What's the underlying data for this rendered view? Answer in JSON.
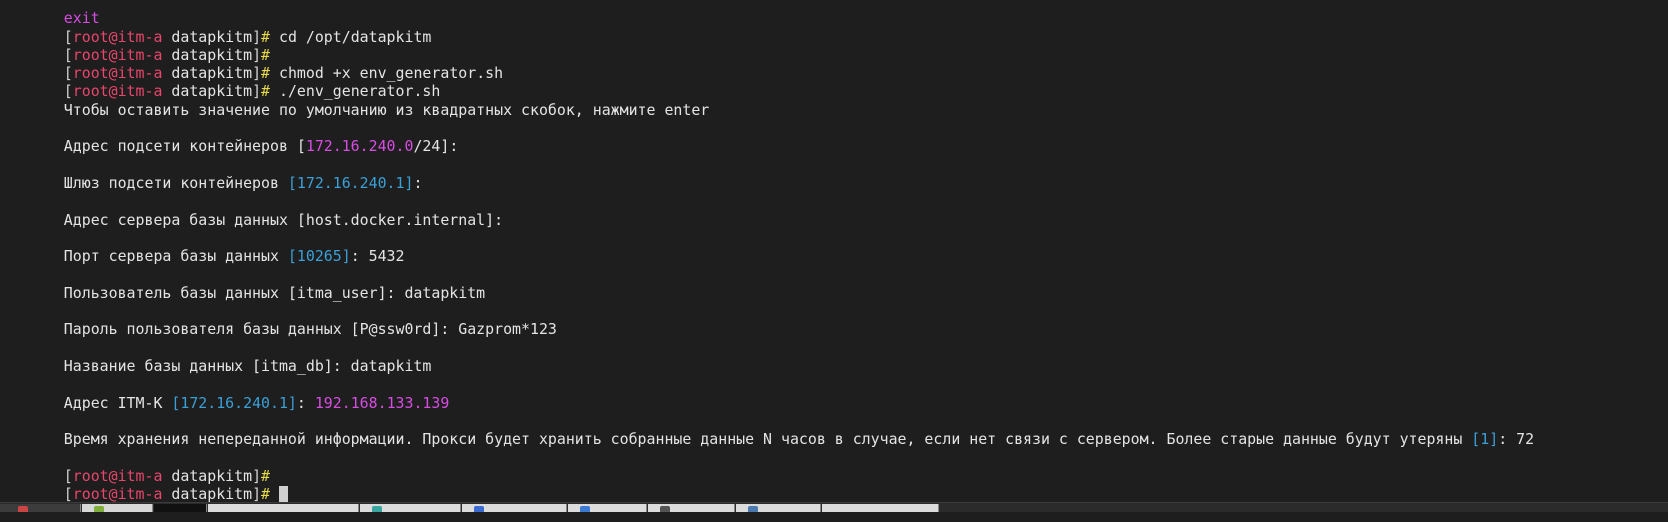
{
  "terminal": {
    "top_partial": "exit",
    "prompt": {
      "open": "[",
      "user_host": "root@itm-a",
      "dir": "datapkitm",
      "close": "]",
      "hash": "#"
    },
    "commands": [
      " cd /opt/datapkitm",
      "",
      " chmod +x env_generator.sh",
      " ./env_generator.sh"
    ],
    "intro": "Чтобы оставить значение по умолчанию из квадратных скобок, нажмите enter",
    "q_subnet": {
      "label": "Адрес подсети контейнеров [",
      "ip": "172.16.240.0",
      "mask": "/24",
      "end": "]:"
    },
    "q_gateway": {
      "label": "Шлюз подсети контейнеров ",
      "default": "[172.16.240.1]",
      "end": ":"
    },
    "q_db_host": "Адрес сервера базы данных [host.docker.internal]:",
    "q_db_port": {
      "label": "Порт сервера базы данных ",
      "default": "[10265]",
      "end": ": ",
      "answer": "5432"
    },
    "q_db_user": "Пользователь базы данных [itma_user]: datapkitm",
    "q_db_pass": "Пароль пользователя базы данных [P@ssw0rd]: Gazprom*123",
    "q_db_name": "Название базы данных [itma_db]: datapkitm",
    "q_itmk": {
      "label": "Адрес ITM-K ",
      "default": "[172.16.240.1]",
      "end": ": ",
      "answer": "192.168.133.139"
    },
    "q_retention": {
      "label": "Время хранения непереданной информации. Прокси будет хранить собранные данные N часов в случае, если нет связи с сервером. Более старые данные будут утеряны ",
      "default": "[1]",
      "end": ": ",
      "answer": "72"
    }
  },
  "colors": {
    "background": "#1e1e1e",
    "prompt_user": "#e8466c",
    "prompt_hash": "#e6d94a",
    "ip_magenta": "#d74ce3",
    "default_blue": "#3aa0d8"
  },
  "taskbar": {
    "items": [
      "app-1",
      "app-2",
      "app-3",
      "app-4",
      "app-5",
      "app-6",
      "app-7",
      "app-8",
      "app-9",
      "app-10"
    ]
  }
}
